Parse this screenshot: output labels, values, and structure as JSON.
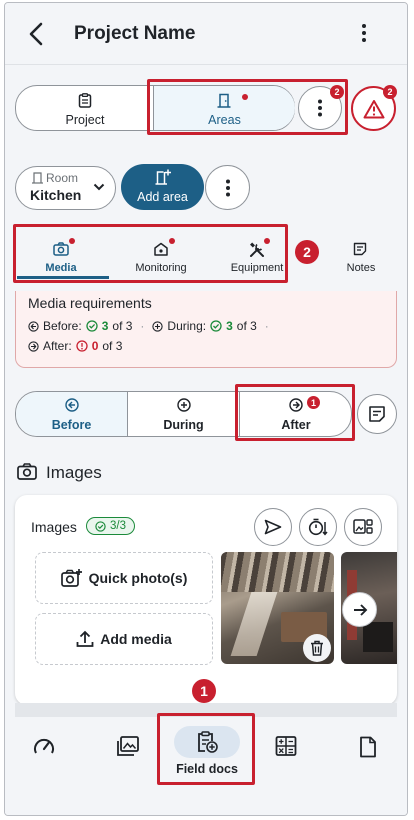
{
  "header": {
    "title": "Project Name"
  },
  "segments": {
    "project_label": "Project",
    "areas_label": "Areas",
    "more_badge": "2",
    "alert_badge": "2"
  },
  "area_bar": {
    "room_caption": "Room",
    "room_value": "Kitchen",
    "add_area_label": "Add area"
  },
  "tabs": [
    {
      "label": "Media"
    },
    {
      "label": "Monitoring"
    },
    {
      "label": "Equipment"
    },
    {
      "label": "Notes"
    }
  ],
  "callouts": {
    "tabs_number": "2",
    "nav_number": "1"
  },
  "requirements": {
    "title": "Media requirements",
    "before_label": "Before:",
    "before_done": "3",
    "before_total": "of 3",
    "during_label": "During:",
    "during_done": "3",
    "during_total": "of 3",
    "after_label": "After:",
    "after_done": "0",
    "after_total": "of 3"
  },
  "phases": {
    "before_label": "Before",
    "during_label": "During",
    "after_label": "After",
    "after_badge": "1"
  },
  "images_section": {
    "heading": "Images",
    "card_title": "Images",
    "count_chip": "3/3",
    "quick_photo_label": "Quick photo(s)",
    "add_media_label": "Add media"
  },
  "bottom_nav": {
    "field_docs_label": "Field docs"
  },
  "colors": {
    "accent": "#1d5f86",
    "alert": "#c8202f",
    "success": "#1b8a3a",
    "add_area_bg": "#1d5f86"
  }
}
